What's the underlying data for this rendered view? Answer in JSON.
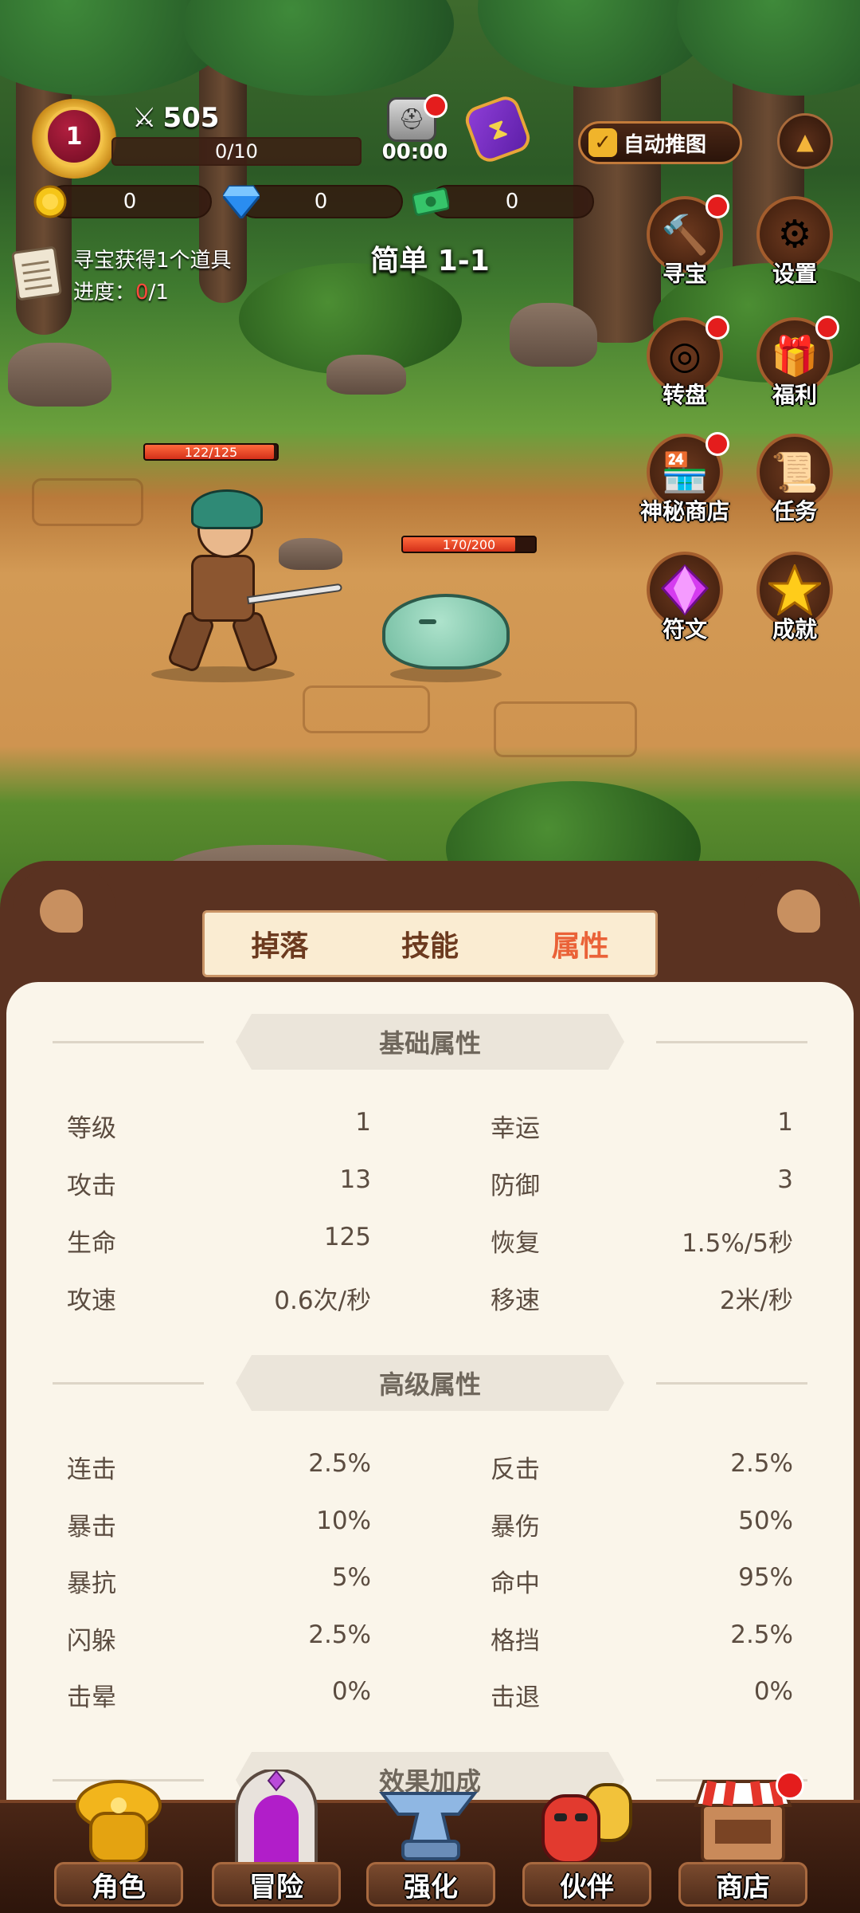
{
  "hud": {
    "level": "1",
    "power": "505",
    "exp_text": "0/10",
    "exp_progress": 0,
    "boss_timer": "00:00",
    "currencies": [
      {
        "name": "gold-coin-icon",
        "value": "0"
      },
      {
        "name": "diamond-icon",
        "value": "0"
      },
      {
        "name": "cash-icon",
        "value": "0"
      }
    ],
    "auto_push_label": "自动推图",
    "auto_push_checked": true
  },
  "quest": {
    "line1": "寻宝获得1个道具",
    "progress_label": "进度：",
    "progress_current": "0",
    "progress_total": "/1"
  },
  "stage": {
    "title": "简单 1-1"
  },
  "side_menu": [
    {
      "label": "寻宝",
      "icon": "hammer-icon",
      "badge": true
    },
    {
      "label": "设置",
      "icon": "gear-icon",
      "badge": false
    },
    {
      "label": "转盘",
      "icon": "wheel-icon",
      "badge": true
    },
    {
      "label": "福利",
      "icon": "gift-icon",
      "badge": true
    },
    {
      "label": "神秘商店",
      "icon": "shop-stall-icon",
      "badge": true
    },
    {
      "label": "任务",
      "icon": "scroll-icon",
      "badge": false
    },
    {
      "label": "符文",
      "icon": "gem-icon",
      "badge": false
    },
    {
      "label": "成就",
      "icon": "star-icon",
      "badge": false
    }
  ],
  "battle": {
    "hero_hp": {
      "text": "122/125",
      "current": 122,
      "max": 125
    },
    "enemy_hp": {
      "text": "170/200",
      "current": 170,
      "max": 200
    }
  },
  "tabs": [
    {
      "label": "掉落",
      "active": false
    },
    {
      "label": "技能",
      "active": false
    },
    {
      "label": "属性",
      "active": true
    }
  ],
  "basic_attrs": {
    "title": "基础属性",
    "rows": [
      {
        "l_label": "等级",
        "l_value": "1",
        "r_label": "幸运",
        "r_value": "1"
      },
      {
        "l_label": "攻击",
        "l_value": "13",
        "r_label": "防御",
        "r_value": "3"
      },
      {
        "l_label": "生命",
        "l_value": "125",
        "r_label": "恢复",
        "r_value": "1.5%/5秒"
      },
      {
        "l_label": "攻速",
        "l_value": "0.6次/秒",
        "r_label": "移速",
        "r_value": "2米/秒"
      }
    ]
  },
  "advanced_attrs": {
    "title": "高级属性",
    "rows": [
      {
        "l_label": "连击",
        "l_value": "2.5%",
        "r_label": "反击",
        "r_value": "2.5%"
      },
      {
        "l_label": "暴击",
        "l_value": "10%",
        "r_label": "暴伤",
        "r_value": "50%"
      },
      {
        "l_label": "暴抗",
        "l_value": "5%",
        "r_label": "命中",
        "r_value": "95%"
      },
      {
        "l_label": "闪躲",
        "l_value": "2.5%",
        "r_label": "格挡",
        "r_value": "2.5%"
      },
      {
        "l_label": "击晕",
        "l_value": "0%",
        "r_label": "击退",
        "r_value": "0%"
      }
    ]
  },
  "effects_section": {
    "title": "效果加成"
  },
  "bottom_nav": [
    {
      "label": "角色",
      "icon": "armor-icon",
      "badge": false
    },
    {
      "label": "冒险",
      "icon": "portal-icon",
      "badge": false
    },
    {
      "label": "强化",
      "icon": "anvil-icon",
      "badge": false
    },
    {
      "label": "伙伴",
      "icon": "companion-icon",
      "badge": false
    },
    {
      "label": "商店",
      "icon": "market-icon",
      "badge": true
    }
  ]
}
